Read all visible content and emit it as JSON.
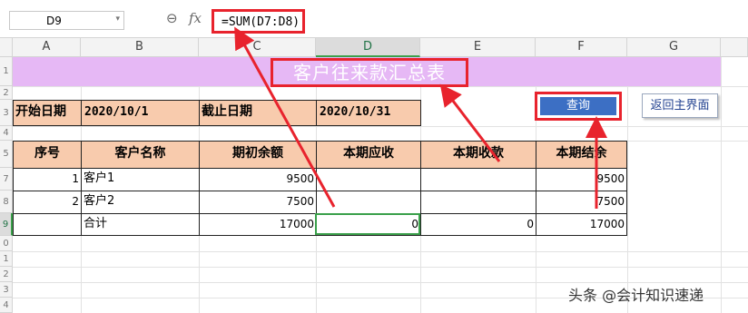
{
  "formula_bar": {
    "name_box": "D9",
    "formula": "=SUM(D7:D8)"
  },
  "columns": [
    "A",
    "B",
    "C",
    "D",
    "E",
    "F",
    "G"
  ],
  "selected_column": "D",
  "rows": [
    "1",
    "2",
    "3",
    "4",
    "5",
    "6",
    "7",
    "8",
    "9",
    "0",
    "1",
    "2",
    "3",
    "4"
  ],
  "sheet": {
    "title": "客户往来款汇总表",
    "start_date_label": "开始日期",
    "start_date_value": "2020/10/1",
    "end_date_label": "截止日期",
    "end_date_value": "2020/10/31",
    "headers": [
      "序号",
      "客户名称",
      "期初余额",
      "本期应收",
      "本期收款",
      "本期结余"
    ],
    "data_rows": [
      {
        "no": "1",
        "name": "客户1",
        "opening": "9500",
        "receivable": "",
        "received": "",
        "balance": "9500"
      },
      {
        "no": "2",
        "name": "客户2",
        "opening": "7500",
        "receivable": "",
        "received": "",
        "balance": "7500"
      }
    ],
    "total_row": {
      "no": "",
      "name": "合计",
      "opening": "17000",
      "receivable": "0",
      "received": "0",
      "balance": "17000"
    }
  },
  "buttons": {
    "query": "查询",
    "back": "返回主界面"
  },
  "watermark": "头条 @会计知识速递",
  "colors": {
    "title_bg": "#e6b8f5",
    "header_bg": "#f8cbad",
    "annotation_red": "#e8232d",
    "query_btn": "#3c6fc4",
    "selection_green": "#3aa04a"
  }
}
